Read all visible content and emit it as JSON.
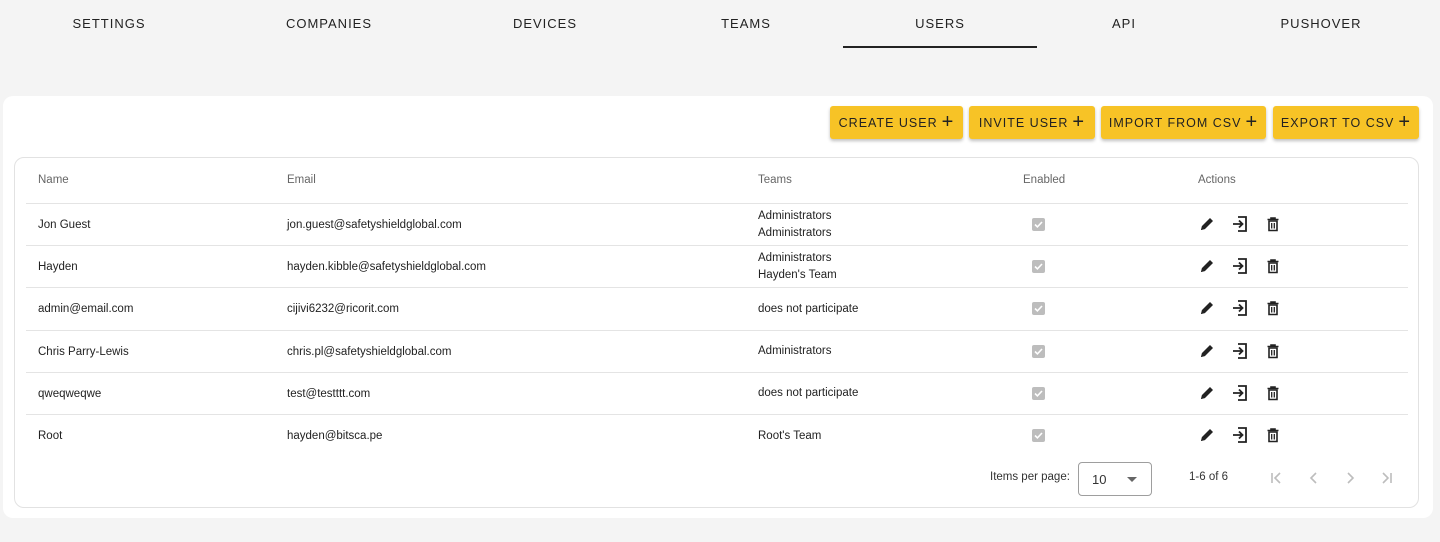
{
  "tabs": [
    {
      "label": "SETTINGS"
    },
    {
      "label": "COMPANIES"
    },
    {
      "label": "DEVICES"
    },
    {
      "label": "TEAMS"
    },
    {
      "label": "USERS",
      "active": true
    },
    {
      "label": "API"
    },
    {
      "label": "PUSHOVER"
    }
  ],
  "toolbar": {
    "create_user": "CREATE USER",
    "invite_user": "INVITE USER",
    "import_csv": "IMPORT FROM CSV",
    "export_csv": "EXPORT TO CSV",
    "plus_icon": "plus-icon"
  },
  "table": {
    "headers": {
      "name": "Name",
      "email": "Email",
      "teams": "Teams",
      "enabled": "Enabled",
      "actions": "Actions"
    },
    "rows": [
      {
        "name": "Jon Guest",
        "email": "jon.guest@safetyshieldglobal.com",
        "teams": [
          "Administrators",
          "Administrators"
        ],
        "enabled": true
      },
      {
        "name": "Hayden",
        "email": "hayden.kibble@safetyshieldglobal.com",
        "teams": [
          "Administrators",
          "Hayden's Team"
        ],
        "enabled": true
      },
      {
        "name": "admin@email.com",
        "email": "cijivi6232@ricorit.com",
        "teams": [
          "does not participate"
        ],
        "enabled": true
      },
      {
        "name": "Chris Parry-Lewis",
        "email": "chris.pl@safetyshieldglobal.com",
        "teams": [
          "Administrators"
        ],
        "enabled": true
      },
      {
        "name": "qweqweqwe",
        "email": "test@testttt.com",
        "teams": [
          "does not participate"
        ],
        "enabled": true
      },
      {
        "name": "Root",
        "email": "hayden@bitsca.pe",
        "teams": [
          "Root's Team"
        ],
        "enabled": true
      }
    ],
    "action_icons": [
      "pencil-icon",
      "login-icon",
      "trash-icon"
    ]
  },
  "paginator": {
    "items_per_page_label": "Items per page:",
    "page_size": "10",
    "range_label": "1-6 of 6"
  },
  "colors": {
    "accent": "#f7c326",
    "background": "#f4f4f4",
    "checkbox_disabled": "#bdbdbd"
  }
}
